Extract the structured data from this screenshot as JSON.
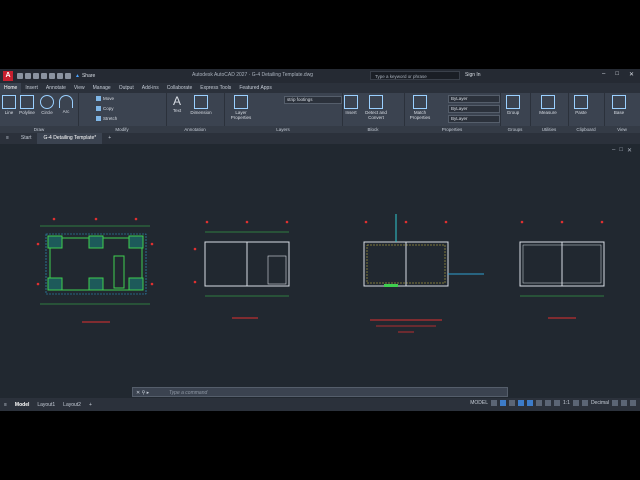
{
  "titlebar": {
    "logo": "A",
    "share": "Share",
    "title": "Autodesk AutoCAD 2027 · G-4 Detailing Template.dwg",
    "search_placeholder": "Type a keyword or phrase",
    "signin": "Sign In"
  },
  "ribbon_tabs": [
    "Home",
    "Insert",
    "Annotate",
    "View",
    "Manage",
    "Output",
    "Add-ins",
    "Collaborate",
    "Express Tools",
    "Featured Apps"
  ],
  "panels": {
    "draw": {
      "label": "Draw",
      "line": "Line",
      "polyline": "Polyline",
      "circle": "Circle",
      "arc": "Arc"
    },
    "modify": {
      "label": "Modify",
      "move": "Move",
      "copy": "Copy",
      "stretch": "Stretch"
    },
    "annotation": {
      "label": "Annotation",
      "text": "Text",
      "dimension": "Dimension"
    },
    "layers": {
      "label": "Layers",
      "layer_properties": "Layer Properties",
      "current_layer": "strip footings"
    },
    "block": {
      "label": "Block",
      "insert": "Insert",
      "detect": "Detect and Convert"
    },
    "properties": {
      "label": "Properties",
      "match": "Match Properties",
      "bylayer1": "ByLayer",
      "bylayer2": "ByLayer",
      "bylayer3": "ByLayer"
    },
    "groups": {
      "label": "Groups",
      "group": "Group"
    },
    "utilities": {
      "label": "Utilities",
      "measure": "Measure"
    },
    "clipboard": {
      "label": "Clipboard",
      "paste": "Paste"
    },
    "view": {
      "label": "View",
      "base": "Base"
    }
  },
  "file_tabs": {
    "start": "Start",
    "active": "G-4 Detailing Template*"
  },
  "command": {
    "placeholder": "Type a command"
  },
  "status": {
    "model": "Model",
    "layout1": "Layout1",
    "layout2": "Layout2",
    "model_space": "MODEL",
    "scale": "1:1",
    "units": "Decimal"
  },
  "colors": {
    "accent": "#4aa3ff",
    "canvas": "#212830",
    "ribbon": "#3b4350"
  },
  "drawing_labels": [
    "Strip footings plan",
    "Ground floor plan",
    "Beam layout",
    "Roof plan"
  ]
}
